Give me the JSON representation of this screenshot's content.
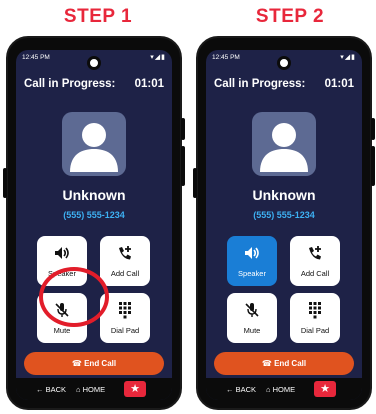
{
  "steps": [
    {
      "title": "STEP 1",
      "status_time": "12:45 PM",
      "header_label": "Call in Progress:",
      "timer": "01:01",
      "caller_name": "Unknown",
      "caller_number": "(555) 555-1234",
      "keys": [
        {
          "label": "Speaker",
          "icon": "speaker-icon",
          "active": false,
          "highlighted": true
        },
        {
          "label": "Add Call",
          "icon": "add-call-icon",
          "active": false
        },
        {
          "label": "Mute",
          "icon": "mute-icon",
          "active": false
        },
        {
          "label": "Dial Pad",
          "icon": "dial-pad-icon",
          "active": false
        }
      ],
      "end_call_label": "End Call",
      "nav": {
        "back": "BACK",
        "home": "HOME"
      }
    },
    {
      "title": "STEP 2",
      "status_time": "12:45 PM",
      "header_label": "Call in Progress:",
      "timer": "01:01",
      "caller_name": "Unknown",
      "caller_number": "(555) 555-1234",
      "keys": [
        {
          "label": "Speaker",
          "icon": "speaker-icon",
          "active": true
        },
        {
          "label": "Add Call",
          "icon": "add-call-icon",
          "active": false
        },
        {
          "label": "Mute",
          "icon": "mute-icon",
          "active": false
        },
        {
          "label": "Dial Pad",
          "icon": "dial-pad-icon",
          "active": false
        }
      ],
      "end_call_label": "End Call",
      "nav": {
        "back": "BACK",
        "home": "HOME"
      }
    }
  ],
  "colors": {
    "step_title": "#e8273b",
    "screen_bg": "#1e2247",
    "number_blue": "#3db0f2",
    "speaker_active": "#1a7ed6",
    "end_call": "#e0531f",
    "highlight_ring": "#e21d2a"
  }
}
